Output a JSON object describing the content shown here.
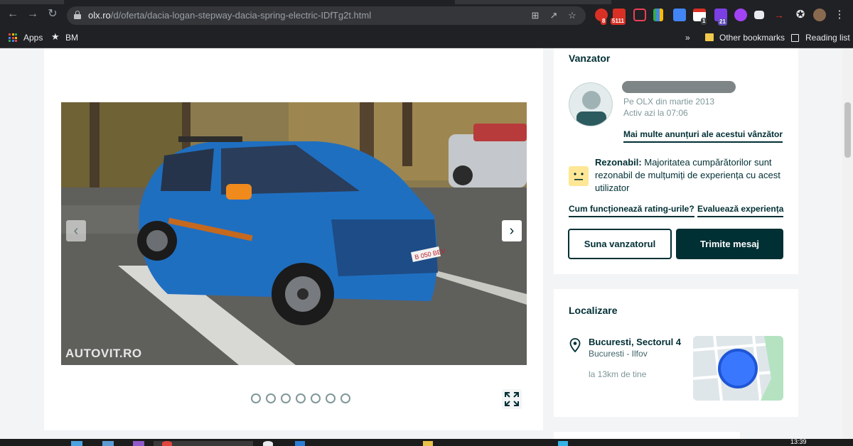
{
  "browser": {
    "url_host": "olx.ro",
    "url_path": "/d/oferta/dacia-logan-stepway-dacia-spring-electric-IDfTg2t.html",
    "extension_badges": [
      "8",
      "5111",
      "1",
      "21"
    ]
  },
  "bookmarks": {
    "apps_label": "Apps",
    "bm_label": "BM",
    "overflow": "»",
    "other_label": "Other bookmarks",
    "reading_list_label": "Reading list"
  },
  "gallery": {
    "watermark": "AUTOVIT.RO",
    "plate_text": "B 050 BEV",
    "image_count": 7,
    "prev_symbol": "‹",
    "next_symbol": "›"
  },
  "seller": {
    "heading": "Vanzator",
    "member_since": "Pe OLX din martie 2013",
    "last_active": "Activ azi la 07:06",
    "more_ads_link": "Mai multe anunțuri ale acestui vânzător",
    "rating_title": "Rezonabil:",
    "rating_text": "Majoritatea cumpărătorilor sunt rezonabil de mulțumiți de experiența cu acest utilizator",
    "how_rating_link": "Cum funcționează rating-urile?",
    "rate_link": "Evaluează experiența",
    "call_button": "Suna vanzatorul",
    "message_button": "Trimite mesaj"
  },
  "location": {
    "heading": "Localizare",
    "city": "Bucuresti, Sectorul 4",
    "region": "Bucuresti - Ilfov",
    "distance": "la 13km de tine"
  },
  "taskbar": {
    "time": "13:39"
  },
  "colors": {
    "brand_dark": "#002f34",
    "rating_yellow": "#ffe796",
    "map_circle": "#3a77ff"
  }
}
